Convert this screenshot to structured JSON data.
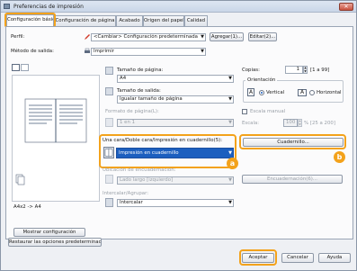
{
  "window": {
    "title": "Preferencias de impresión",
    "close_label": "✕"
  },
  "tabs": [
    {
      "label": "Configuración básica"
    },
    {
      "label": "Configuración de página"
    },
    {
      "label": "Acabado"
    },
    {
      "label": "Origen del papel"
    },
    {
      "label": "Calidad"
    }
  ],
  "profile": {
    "label": "Perfil:",
    "value": "<Cambiar> Configuración predeterminada",
    "add_button": "Agregar(1)...",
    "edit_button": "Editar(2)..."
  },
  "output_method": {
    "label": "Método de salida:",
    "value": "Imprimir"
  },
  "page_size": {
    "label": "Tamaño de página:",
    "value": "A4"
  },
  "output_size": {
    "label": "Tamaño de salida:",
    "value": "Igualar tamaño de página"
  },
  "page_layout": {
    "label": "Formato de página(L):",
    "value": "1 en 1"
  },
  "duplex": {
    "label": "Una cara/Doble cara/Impresión en cuadernillo(5):",
    "value": "Impresión en cuadernillo",
    "booklet_button": "Cuadernillo..."
  },
  "binding": {
    "label": "Ubicación de encuadernación:",
    "value": "Lado largo [izquierdo]",
    "button": "Encuadernación(6)..."
  },
  "collate": {
    "label": "Intercalar/Agrupar:",
    "value": "Intercalar"
  },
  "copies": {
    "label": "Copias:",
    "value": "1",
    "range": "[1 a 99]"
  },
  "orientation": {
    "label": "Orientación",
    "portrait": "Vertical",
    "landscape": "Horizontal",
    "portrait_glyph": "A",
    "landscape_glyph": "A"
  },
  "manual_scaling": {
    "label": "Escala manual",
    "scale_label": "Escala:",
    "value": "100",
    "range": "% [25 a 200]"
  },
  "preview": {
    "caption": "A4x2 -> A4"
  },
  "left_buttons": {
    "show": "Mostrar configuración",
    "restore": "Restaurar las opciones predeterminadas"
  },
  "footer": {
    "accept": "Aceptar",
    "cancel": "Cancelar",
    "help": "Ayuda"
  },
  "callouts": {
    "a": "a",
    "b": "b"
  },
  "colors": {
    "accent_orange": "#f3a21b",
    "selection_blue": "#1c5fbf"
  }
}
